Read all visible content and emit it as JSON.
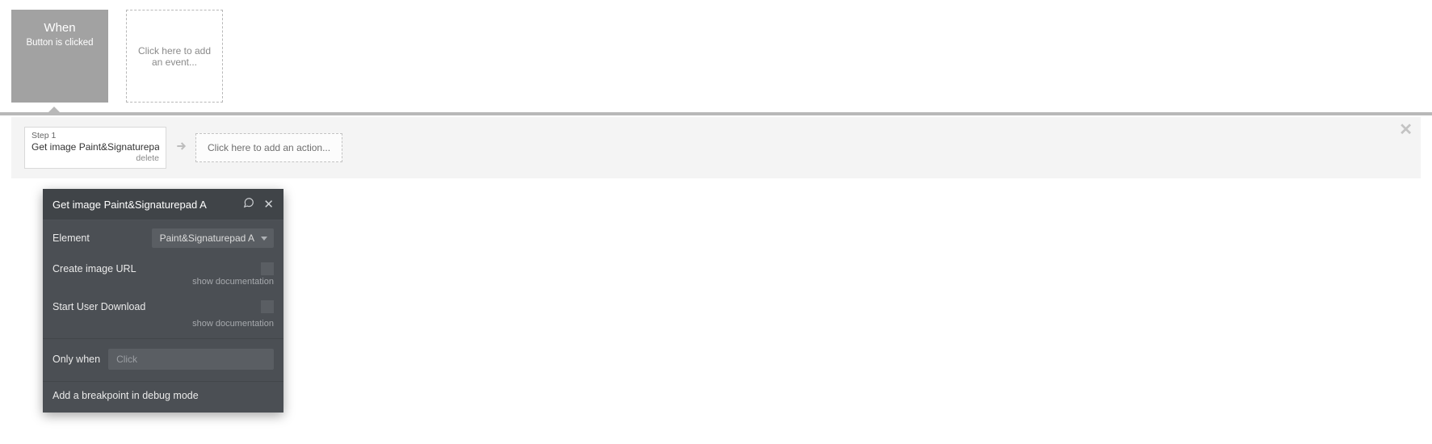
{
  "event": {
    "when_label": "When",
    "description": "Button is clicked"
  },
  "add_event_label": "Click here to add an event...",
  "steps": {
    "step1_num": "Step 1",
    "step1_title": "Get image Paint&Signaturepad A",
    "step1_delete": "delete"
  },
  "add_action_label": "Click here to add an action...",
  "panel": {
    "title": "Get image Paint&Signaturepad A",
    "element_label": "Element",
    "element_value": "Paint&Signaturepad A",
    "create_url_label": "Create image URL",
    "download_label": "Start User Download",
    "show_doc": "show documentation",
    "only_when_label": "Only when",
    "only_when_placeholder": "Click",
    "breakpoint_label": "Add a breakpoint in debug mode"
  }
}
